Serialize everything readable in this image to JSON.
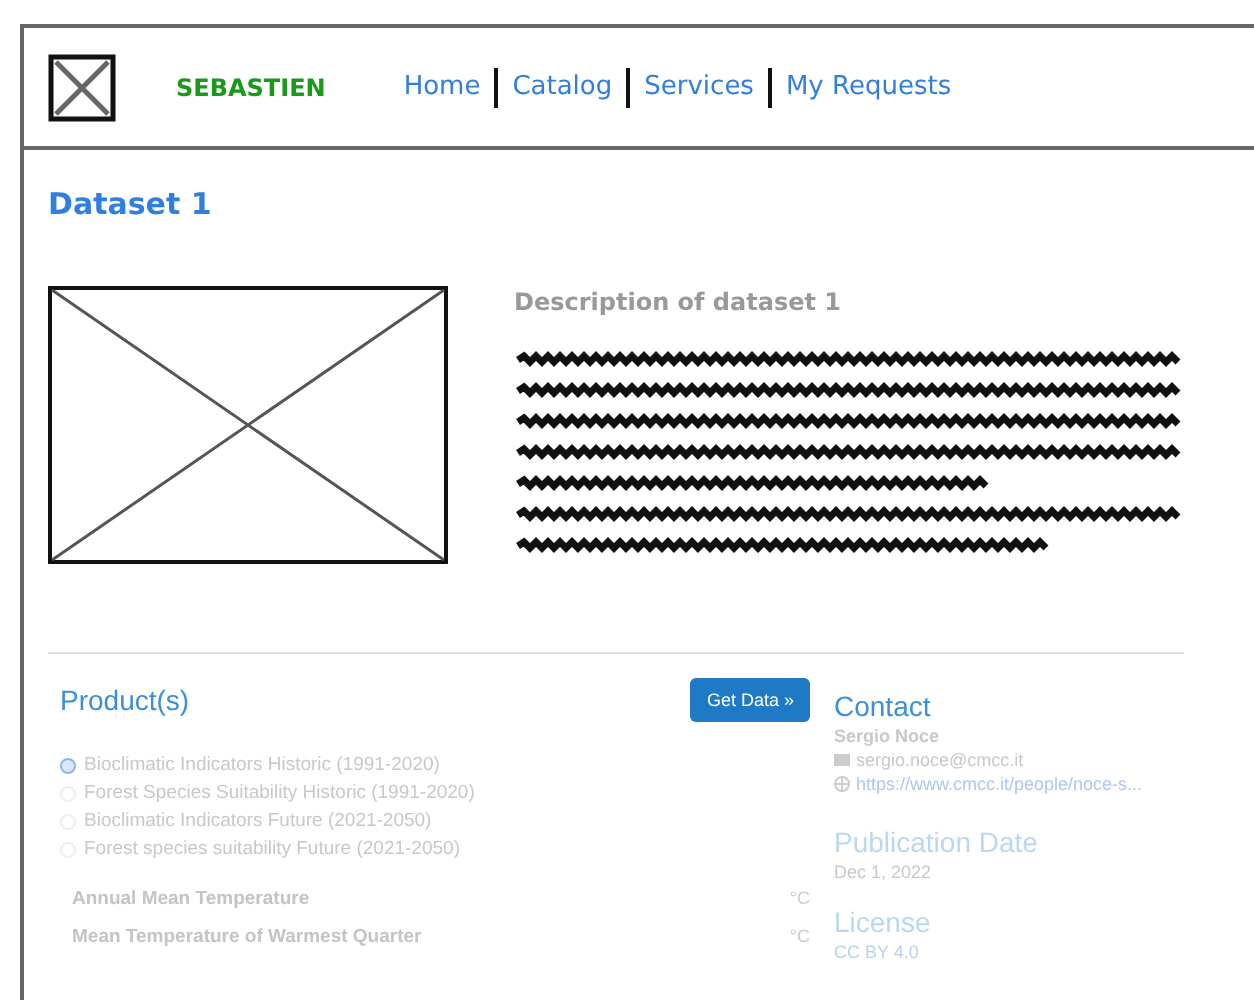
{
  "header": {
    "brand": "SEBASTIEN",
    "nav": [
      {
        "label": "Home"
      },
      {
        "label": "Catalog"
      },
      {
        "label": "Services"
      },
      {
        "label": "My Requests"
      }
    ]
  },
  "dataset": {
    "title": "Dataset 1",
    "description_title": "Description of dataset 1"
  },
  "products": {
    "title": "Product(s)",
    "button": "Get Data »",
    "options": [
      {
        "label": "Bioclimatic Indicators Historic (1991-2020)",
        "selected": true
      },
      {
        "label": "Forest Species Suitability Historic (1991-2020)",
        "selected": false
      },
      {
        "label": "Bioclimatic Indicators Future (2021-2050)",
        "selected": false
      },
      {
        "label": "Forest species suitability Future (2021-2050)",
        "selected": false
      }
    ],
    "variables": [
      {
        "name": "Annual Mean Temperature",
        "unit": "°C"
      },
      {
        "name": "Mean Temperature of Warmest Quarter",
        "unit": "°C"
      }
    ]
  },
  "contact": {
    "title": "Contact",
    "name": "Sergio Noce",
    "email": "sergio.noce@cmcc.it",
    "url": "https://www.cmcc.it/people/noce-s..."
  },
  "publication": {
    "title": "Publication Date",
    "date": "Dec 1, 2022"
  },
  "license": {
    "title": "License",
    "value": "CC BY 4.0"
  }
}
